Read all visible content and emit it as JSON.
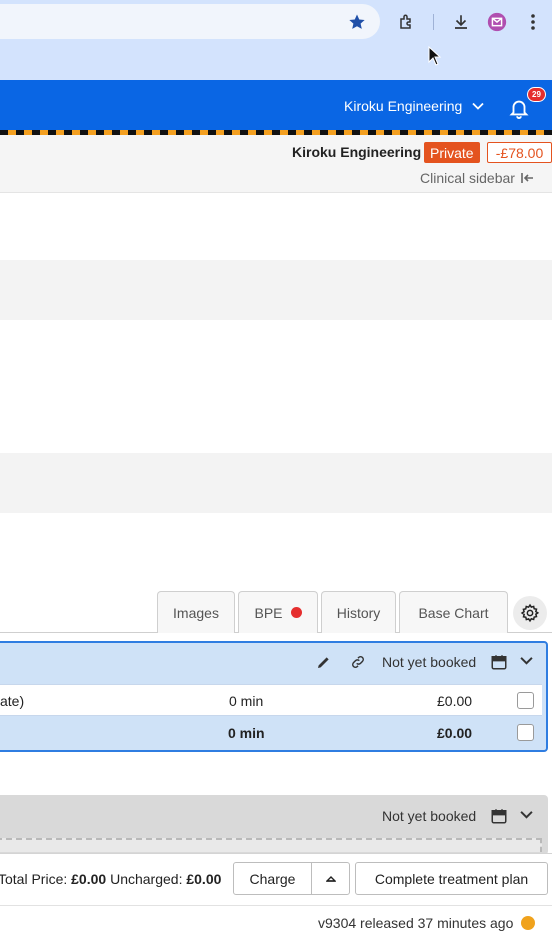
{
  "header": {
    "org_name": "Kiroku Engineering",
    "notification_count": "29",
    "brand_color": "#0a66e4"
  },
  "patient_bar": {
    "name": "Kiroku Engineering",
    "account_type": "Private",
    "balance": "-£78.00",
    "clinical_sidebar_label": "Clinical sidebar"
  },
  "tabs": [
    {
      "label": "Images"
    },
    {
      "label": "BPE"
    },
    {
      "label": "History"
    },
    {
      "label": "Base Chart"
    }
  ],
  "treatment_plan": {
    "status": "Not yet booked",
    "rows": [
      {
        "name": "ate)",
        "duration": "0 min",
        "price": "£0.00"
      },
      {
        "name": "",
        "duration": "0 min",
        "price": "£0.00"
      }
    ]
  },
  "treatment_plan_2": {
    "status": "Not yet booked"
  },
  "footer": {
    "total_label": "Total Price:",
    "total_value": "£0.00",
    "uncharged_label": "Uncharged:",
    "uncharged_value": "£0.00",
    "charge_label": "Charge",
    "complete_label": "Complete treatment plan"
  },
  "version": {
    "text": "v9304 released 37 minutes ago"
  }
}
